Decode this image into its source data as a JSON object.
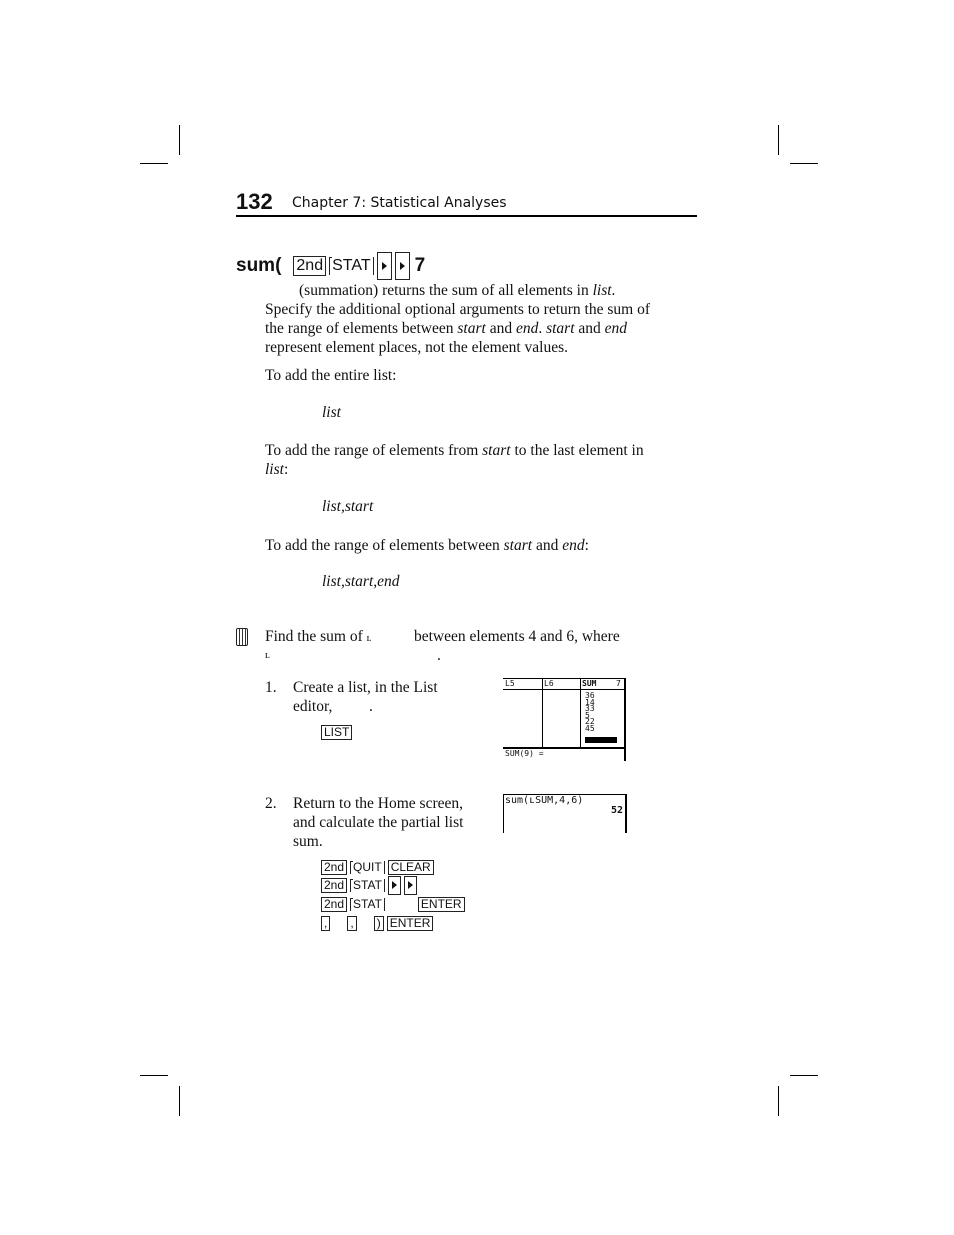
{
  "header": {
    "page_number": "132",
    "chapter": "Chapter 7: Statistical Analyses"
  },
  "entry": {
    "title": "sum(",
    "keys": [
      "2nd",
      "STAT",
      "right-arrow",
      "right-arrow",
      "7"
    ],
    "description": [
      "(summation) returns the sum of all elements in ",
      "list",
      ".",
      "Specify the additional optional arguments to return the sum of",
      "the range of elements between ",
      "start",
      " and ",
      "end",
      ". ",
      "start",
      " and ",
      "end",
      "represent element places, not the element values."
    ],
    "case1": {
      "text": "To add the entire list:",
      "syntax": "list"
    },
    "case2": {
      "text1": "To add the range of elements from ",
      "start": "start",
      "text2": " to the last element in",
      "list": "list",
      "colon": ":",
      "syntax": "list,start"
    },
    "case3": {
      "text1": "To add the range of elements between ",
      "start": "start",
      "and": " and ",
      "end": "end",
      "colon": ":",
      "syntax": "list,start,end"
    }
  },
  "example": {
    "icon": "calculator-icon",
    "intro1a": "Find the sum of ",
    "listchar": "ʟ",
    "intro1b": "between elements 4 and 6, where",
    "intro2": "ʟ",
    "intro2end": ".",
    "step1": {
      "num": "1.",
      "line1": "Create a list, in the List",
      "line2": "editor,",
      "line2end": ".",
      "key": "LIST"
    },
    "screen1": {
      "headers": [
        "L5",
        "L6",
        "SUM",
        "7"
      ],
      "values": [
        "36",
        "14",
        "33",
        "5",
        "22",
        "45"
      ],
      "footer": "SUM(9) ="
    },
    "step2": {
      "num": "2.",
      "line1": "Return to the Home screen,",
      "line2": "and calculate the partial list",
      "line3": "sum.",
      "keys": [
        [
          "2nd",
          "QUIT",
          "CLEAR"
        ],
        [
          "2nd",
          "STAT",
          "right-arrow",
          "right-arrow"
        ],
        [
          "2nd",
          "STAT",
          "ENTER"
        ],
        [
          ",",
          ",",
          ")",
          "ENTER"
        ]
      ]
    },
    "screen2": {
      "expression": "sum(ʟSUM,4,6)",
      "result": "52"
    }
  }
}
